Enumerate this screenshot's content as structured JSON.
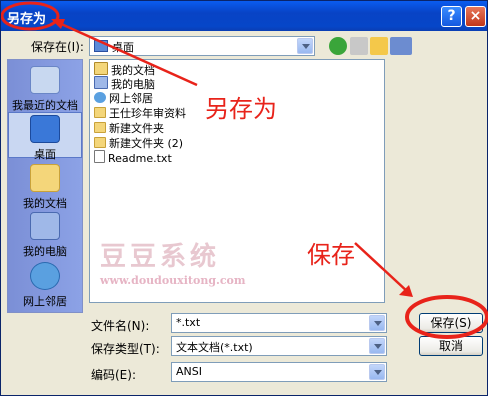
{
  "dialog": {
    "title": "另存为",
    "help_glyph": "?",
    "close_glyph": "×"
  },
  "toolbar": {
    "save_in_label": "保存在(I):",
    "location": "桌面"
  },
  "places": [
    {
      "label": "我最近的文档",
      "icon": "recent-documents-icon"
    },
    {
      "label": "桌面",
      "icon": "desktop-icon"
    },
    {
      "label": "我的文档",
      "icon": "my-documents-icon"
    },
    {
      "label": "我的电脑",
      "icon": "my-computer-icon"
    },
    {
      "label": "网上邻居",
      "icon": "network-places-icon"
    }
  ],
  "files": [
    {
      "name": "我的文档",
      "icon": "my-documents-icon"
    },
    {
      "name": "我的电脑",
      "icon": "my-computer-icon"
    },
    {
      "name": "网上邻居",
      "icon": "network-places-icon"
    },
    {
      "name": "王仕珍年审资料",
      "icon": "folder-icon"
    },
    {
      "name": "新建文件夹",
      "icon": "folder-icon"
    },
    {
      "name": "新建文件夹 (2)",
      "icon": "folder-icon"
    },
    {
      "name": "Readme.txt",
      "icon": "text-file-icon"
    }
  ],
  "form": {
    "filename_label": "文件名(N):",
    "filename_value": "*.txt",
    "filetype_label": "保存类型(T):",
    "filetype_value": "文本文档(*.txt)",
    "encoding_label": "编码(E):",
    "encoding_value": "ANSI",
    "save_button": "保存(S)",
    "cancel_button": "取消"
  },
  "annotations": {
    "saveas_note": "另存为",
    "save_note": "保存",
    "watermark_cn": "豆豆系统",
    "watermark_url": "www.doudouxitong.com"
  },
  "colors": {
    "annotation_red": "#E8231A",
    "titlebar_blue": "#0843C5"
  }
}
